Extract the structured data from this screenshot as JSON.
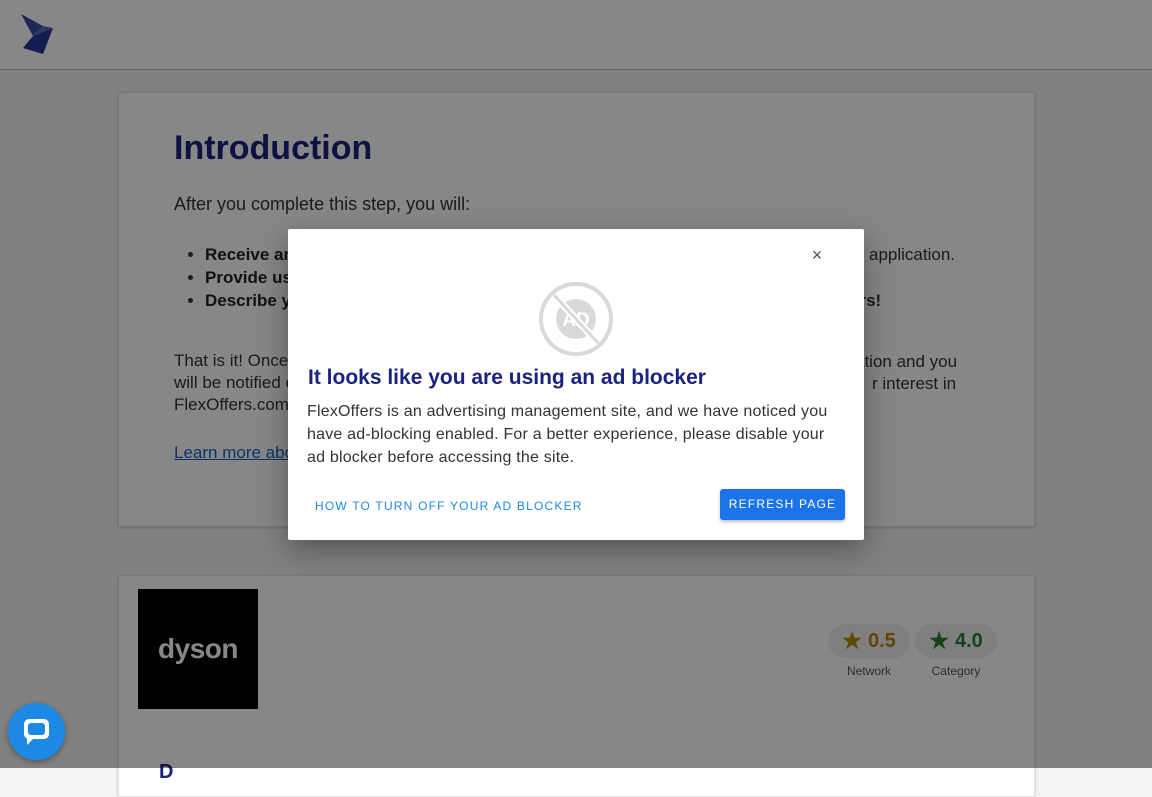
{
  "header": {
    "logo_icon": "flexoffers-logo-icon"
  },
  "intro": {
    "title": "Introduction",
    "lead": "After you complete this step, you will:",
    "bullets": [
      "Receive an",
      "Provide us",
      "Describe y"
    ],
    "bullet_tails": [
      "application.",
      "ers!"
    ],
    "para": "That is it! Once",
    "para_line2": "will be notified o",
    "para_line3": "FlexOffers.com",
    "para_tail1": "ation and you",
    "para_tail2": "r interest in",
    "link": "Learn more abo"
  },
  "advertiser": {
    "logo_text": "dyson",
    "rating_network": {
      "value": "0.5",
      "label": "Network",
      "icon": "star-icon",
      "color": "#b8860b"
    },
    "rating_category": {
      "value": "4.0",
      "label": "Category",
      "icon": "star-icon",
      "color": "#2e7d32"
    },
    "name_partial": "D"
  },
  "modal": {
    "close_label": "×",
    "icon": "ad-blocked-icon",
    "icon_text": "AD",
    "title": "It looks like you are using an ad blocker",
    "body": "FlexOffers is an advertising management site, and we have noticed you have ad-blocking enabled. For a better experience, please disable your ad blocker before accessing the site.",
    "secondary_button": "HOW TO TURN OFF YOUR AD BLOCKER",
    "primary_button": "REFRESH PAGE"
  },
  "chat": {
    "icon": "chat-bubble-icon"
  },
  "colors": {
    "accent": "#1a73e8",
    "title": "#1a237e"
  }
}
